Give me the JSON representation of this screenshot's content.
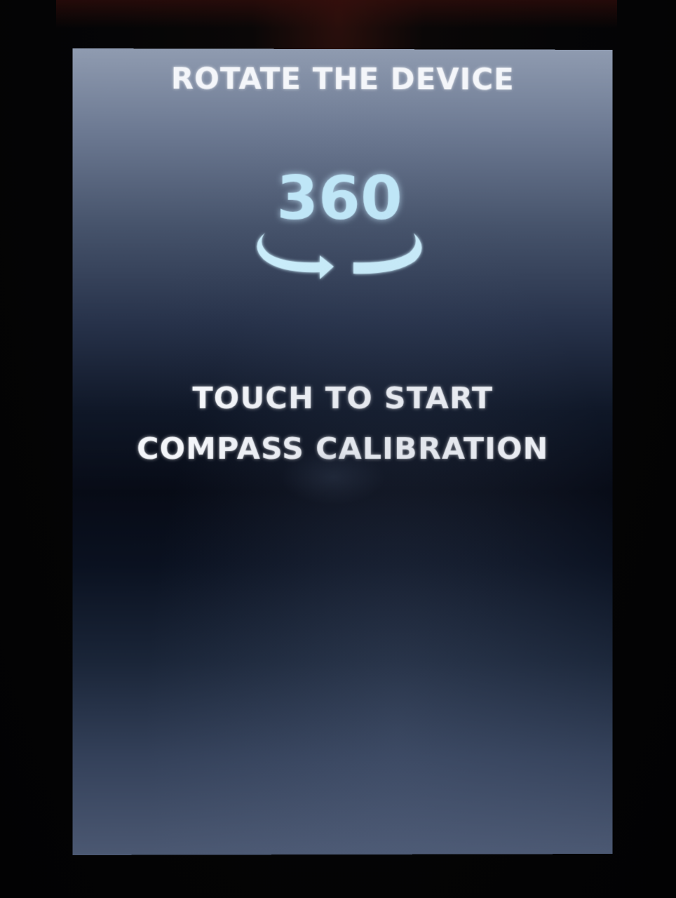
{
  "screen": {
    "heading": "ROTATE THE DEVICE",
    "rotation_value": "360",
    "cta_line1": "TOUCH TO START",
    "cta_line2": "COMPASS CALIBRATION",
    "icon": "rotate-360-icon"
  },
  "colors": {
    "accent": "#bfe6f7",
    "text": "#f4f6fa"
  }
}
